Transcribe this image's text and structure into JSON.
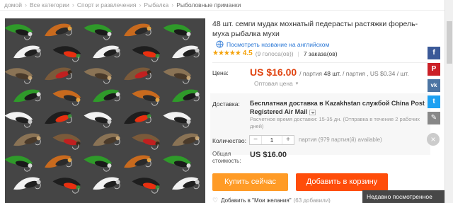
{
  "breadcrumb": {
    "items": [
      "домой",
      "Все категории",
      "Спорт и развлечения",
      "Рыбалка"
    ],
    "current": "Рыболовные приманки",
    "separator": "›"
  },
  "product": {
    "title": "48 шт. семги мудак мохнатый педерасты растяжки форель-муха рыбалка мухи",
    "translate_link": "Посмотреть название на английском",
    "stars": "★★★★★",
    "rating": "4.5",
    "votes": "(9 голоса(ов))",
    "orders_sep": "|",
    "orders": "7 заказа(ов)"
  },
  "price": {
    "label": "Цена:",
    "value": "US $16.00",
    "unit_prefix": "/ партия",
    "unit_count": "48 шт.",
    "unit_suffix": "/ партия , US $0.34 / шт.",
    "wholesale": "Оптовая цена",
    "wholesale_caret": "▾"
  },
  "shipping": {
    "label": "Доставка:",
    "method": "Бесплатная доставка в Kazakhstan службой China Post Registered Air Mail",
    "time": "Расчетное время доставки: 15-35 дн. (Отправка в течение 2 рабочих дней)"
  },
  "quantity": {
    "label": "Количество:",
    "minus": "−",
    "value": "1",
    "plus": "+",
    "available": "партия (979 партия(й) available)"
  },
  "total": {
    "label_line1": "Общая",
    "label_line2": "стоимость:",
    "value": "US $16.00"
  },
  "actions": {
    "buy_now": "Купить сейчас",
    "add_to_cart": "Добавить в корзину",
    "wishlist": "Добавить в \"Мои желания\"",
    "wishlist_count": "(63 добавили)",
    "heart": "♡"
  },
  "social": {
    "facebook": "f",
    "pinterest": "P",
    "vk": "vk",
    "twitter": "t",
    "edit": "✎",
    "close": "×",
    "colors": {
      "facebook": "#3b5998",
      "pinterest": "#cb2027",
      "vk": "#4c75a3",
      "twitter": "#1da1f2",
      "edit": "#888888"
    }
  },
  "recently_viewed": "Недавно посмотренное",
  "colors": {
    "accent_price": "#e04411",
    "buy_button": "#ff9b26",
    "cart_button": "#ff4d0a",
    "link": "#2b78d6",
    "stars": "#f4a20a"
  }
}
